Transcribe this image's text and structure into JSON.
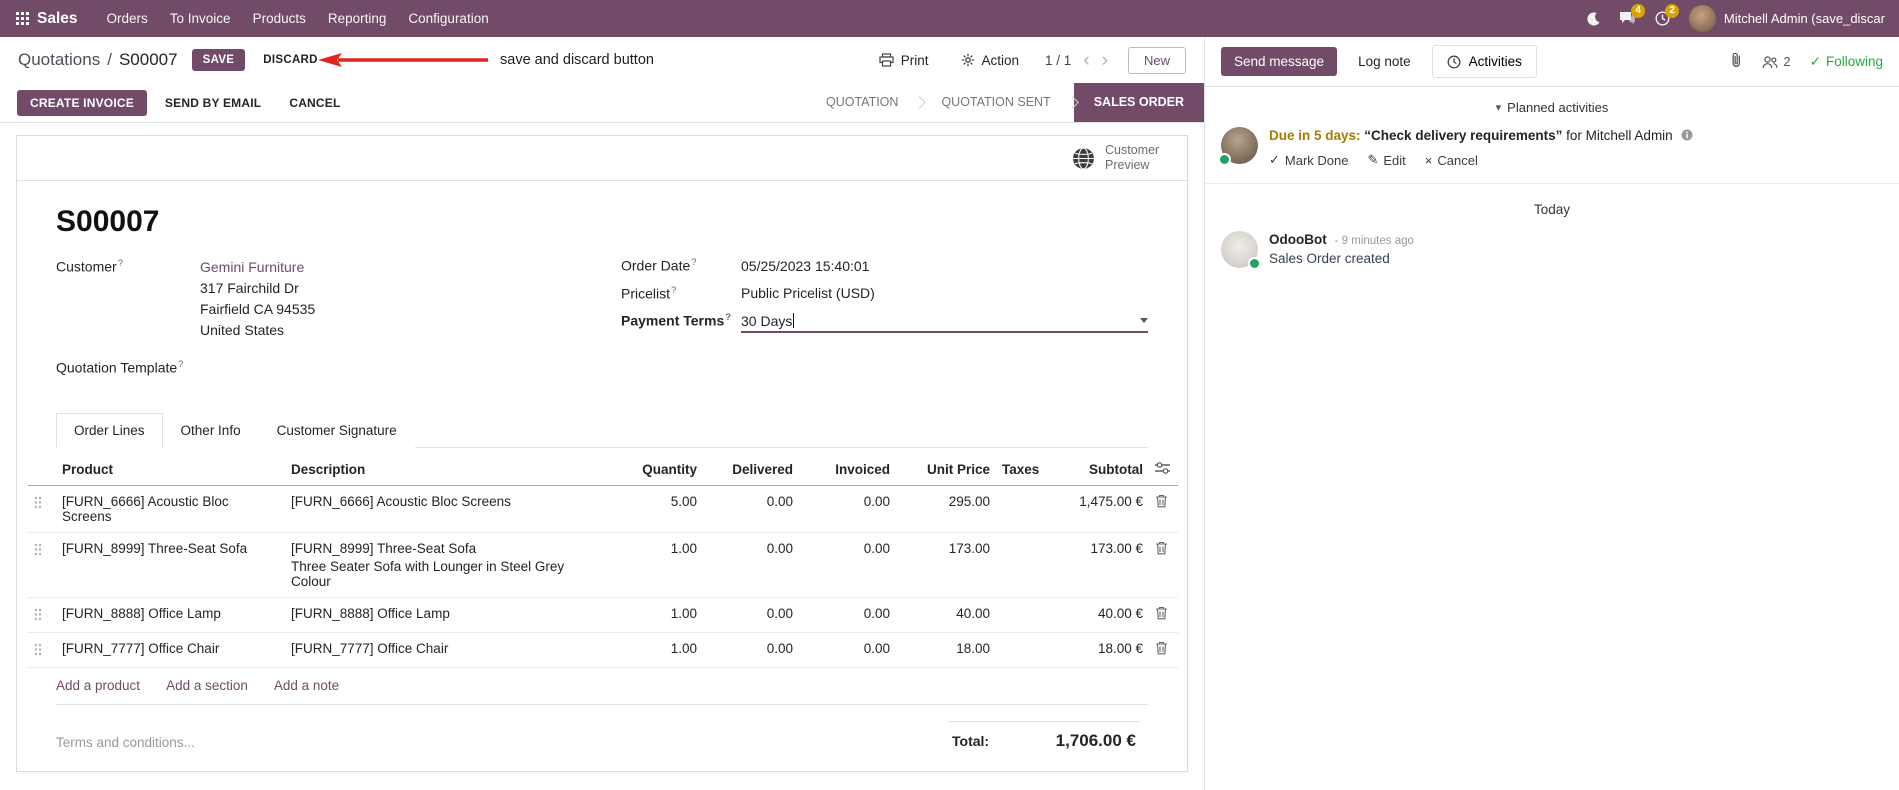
{
  "colors": {
    "brand": "#714B67",
    "edited_value": "#017e84",
    "link": "#714B67",
    "following_green": "#28a745",
    "annotation_arrow": "#e0261f",
    "activity_due": "#a87b00"
  },
  "icons": {
    "pager_prev": "‹",
    "pager_next": "›",
    "collapse_caret": "▾",
    "check": "✓",
    "edit": "✎",
    "cancel": "×",
    "breadcrumb_sep": "/"
  },
  "navbar": {
    "app_name": "Sales",
    "menus": [
      {
        "label": "Orders"
      },
      {
        "label": "To Invoice"
      },
      {
        "label": "Products"
      },
      {
        "label": "Reporting"
      },
      {
        "label": "Configuration"
      }
    ],
    "messages_badge": "4",
    "activities_badge": "2",
    "user_name": "Mitchell Admin (save_discar"
  },
  "control_panel": {
    "breadcrumb_parent": "Quotations",
    "breadcrumb_current": "S00007",
    "save_label": "SAVE",
    "discard_label": "DISCARD",
    "annotation_text": "save and discard button",
    "print_label": "Print",
    "action_label": "Action",
    "pager_value": "1 / 1",
    "new_label": "New"
  },
  "statusbar": {
    "create_invoice": "CREATE INVOICE",
    "send_by_email": "SEND BY EMAIL",
    "cancel": "CANCEL",
    "states": [
      {
        "label": "QUOTATION"
      },
      {
        "label": "QUOTATION SENT"
      },
      {
        "label": "SALES ORDER"
      }
    ]
  },
  "form": {
    "preview_button": "Customer Preview",
    "title": "S00007",
    "help_marker": "?",
    "customer_label": "Customer",
    "customer_name": "Gemini Furniture",
    "customer_street": "317 Fairchild Dr",
    "customer_city": "Fairfield CA 94535",
    "customer_country": "United States",
    "quotation_template_label": "Quotation Template",
    "order_date_label": "Order Date",
    "order_date_value": "05/25/2023 15:40:01",
    "pricelist_label": "Pricelist",
    "pricelist_value": "Public Pricelist (USD)",
    "payment_terms_label": "Payment Terms",
    "payment_terms_value": "30 Days",
    "tabs": [
      {
        "label": "Order Lines"
      },
      {
        "label": "Other Info"
      },
      {
        "label": "Customer Signature"
      }
    ],
    "table": {
      "headers": {
        "product": "Product",
        "description": "Description",
        "quantity": "Quantity",
        "delivered": "Delivered",
        "invoiced": "Invoiced",
        "unit_price": "Unit Price",
        "taxes": "Taxes",
        "subtotal": "Subtotal"
      },
      "rows": [
        {
          "product": "[FURN_6666] Acoustic Bloc Screens",
          "description": "[FURN_6666] Acoustic Bloc Screens",
          "description2": "",
          "quantity": "5.00",
          "delivered": "0.00",
          "invoiced": "0.00",
          "unit_price": "295.00",
          "taxes": "",
          "subtotal": "1,475.00 €"
        },
        {
          "product": "[FURN_8999] Three-Seat Sofa",
          "description": "[FURN_8999] Three-Seat Sofa",
          "description2": "Three Seater Sofa with Lounger in Steel Grey Colour",
          "quantity": "1.00",
          "delivered": "0.00",
          "invoiced": "0.00",
          "unit_price": "173.00",
          "taxes": "",
          "subtotal": "173.00 €"
        },
        {
          "product": "[FURN_8888] Office Lamp",
          "description": "[FURN_8888] Office Lamp",
          "description2": "",
          "quantity": "1.00",
          "delivered": "0.00",
          "invoiced": "0.00",
          "unit_price": "40.00",
          "taxes": "",
          "subtotal": "40.00 €"
        },
        {
          "product": "[FURN_7777] Office Chair",
          "description": "[FURN_7777] Office Chair",
          "description2": "",
          "quantity": "1.00",
          "delivered": "0.00",
          "invoiced": "0.00",
          "unit_price": "18.00",
          "taxes": "",
          "subtotal": "18.00 €"
        }
      ],
      "add_product": "Add a product",
      "add_section": "Add a section",
      "add_note": "Add a note"
    },
    "terms_placeholder": "Terms and conditions...",
    "total_label": "Total:",
    "total_value": "1,706.00 €"
  },
  "chatter": {
    "send_message": "Send message",
    "log_note": "Log note",
    "activities": "Activities",
    "followers_count": "2",
    "following_label": "Following",
    "planned_header": "Planned activities",
    "activity": {
      "due": "Due in 5 days:",
      "summary": "“Check delivery requirements”",
      "for_text": "for Mitchell Admin",
      "mark_done": "Mark Done",
      "edit": "Edit",
      "cancel": "Cancel"
    },
    "today_label": "Today",
    "message": {
      "author": "OdooBot",
      "time": "- 9 minutes ago",
      "body": "Sales Order created"
    }
  }
}
